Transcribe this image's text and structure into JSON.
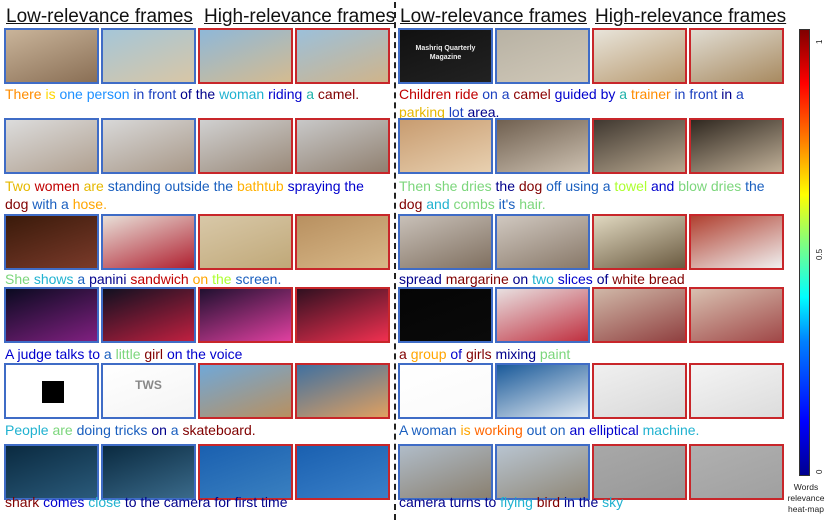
{
  "headers": {
    "left_low": "Low-relevance frames",
    "left_high": "High-relevance frames",
    "right_low": "Low-relevance frames",
    "right_high": "High-relevance frames"
  },
  "colorbar": {
    "tick_top": "1",
    "tick_mid": "0.5",
    "tick_bottom": "0",
    "label": "Words relevance heat-map",
    "gradient_colors": [
      "#00008f",
      "#0000ff",
      "#0080ff",
      "#00ffff",
      "#80ff80",
      "#ffff00",
      "#ff8000",
      "#ff0000",
      "#800000"
    ]
  },
  "rows": [
    {
      "left": {
        "frames": [
          {
            "type": "low",
            "colors": [
              "#c9b49a",
              "#8a6f55"
            ]
          },
          {
            "type": "low",
            "colors": [
              "#a5c6d8",
              "#d8c6a6"
            ]
          },
          {
            "type": "high",
            "colors": [
              "#8fb8d8",
              "#d4bb90"
            ]
          },
          {
            "type": "high",
            "colors": [
              "#9cc0da",
              "#d0b48a"
            ]
          }
        ],
        "words": [
          {
            "t": "There ",
            "c": "#ff8c00"
          },
          {
            "t": "is ",
            "c": "#ffd700"
          },
          {
            "t": "one ",
            "c": "#1e90ff"
          },
          {
            "t": "person ",
            "c": "#1e90ff"
          },
          {
            "t": "in front ",
            "c": "#1a3fbf"
          },
          {
            "t": "of ",
            "c": "#00008b"
          },
          {
            "t": "the ",
            "c": "#00008b"
          },
          {
            "t": "woman ",
            "c": "#20b2d0"
          },
          {
            "t": "riding ",
            "c": "#0000cd"
          },
          {
            "t": "a ",
            "c": "#20b2aa"
          },
          {
            "t": "camel.",
            "c": "#800000"
          }
        ]
      },
      "right": {
        "frames": [
          {
            "type": "low",
            "colors": [
              "#111111",
              "#222222"
            ],
            "text": "Mashriq Quarterly Magazine"
          },
          {
            "type": "low",
            "colors": [
              "#b8b2a4",
              "#d0c8b8"
            ]
          },
          {
            "type": "high",
            "colors": [
              "#e8e4da",
              "#b89a70"
            ]
          },
          {
            "type": "high",
            "colors": [
              "#e0dcd2",
              "#a88a60"
            ]
          }
        ],
        "words": [
          {
            "t": "Children ",
            "c": "#c00000"
          },
          {
            "t": "ride ",
            "c": "#c00000"
          },
          {
            "t": "on ",
            "c": "#1a3fbf"
          },
          {
            "t": "a ",
            "c": "#1a3fbf"
          },
          {
            "t": "camel ",
            "c": "#8b0000"
          },
          {
            "t": "guided ",
            "c": "#0000cd"
          },
          {
            "t": "by ",
            "c": "#0000cd"
          },
          {
            "t": "a ",
            "c": "#20b2aa"
          },
          {
            "t": "trainer ",
            "c": "#ff8c00"
          },
          {
            "t": "in front ",
            "c": "#1a3fbf"
          },
          {
            "t": "in ",
            "c": "#00008b"
          },
          {
            "t": "a ",
            "c": "#1a3fbf"
          },
          {
            "t": "parking ",
            "c": "#e6b800"
          },
          {
            "t": "lot ",
            "c": "#1a3fbf"
          },
          {
            "t": "area.",
            "c": "#00008b"
          }
        ]
      }
    },
    {
      "left": {
        "frames": [
          {
            "type": "low",
            "colors": [
              "#dcdcdc",
              "#b0a090"
            ]
          },
          {
            "type": "low",
            "colors": [
              "#d8d8d8",
              "#a89888"
            ]
          },
          {
            "type": "high",
            "colors": [
              "#d0d0d0",
              "#9a8a7a"
            ]
          },
          {
            "type": "high",
            "colors": [
              "#c8c8c8",
              "#908070"
            ]
          }
        ],
        "words": [
          {
            "t": "Two ",
            "c": "#e6b800"
          },
          {
            "t": "women ",
            "c": "#c00000"
          },
          {
            "t": "are ",
            "c": "#e6b800"
          },
          {
            "t": "standing ",
            "c": "#1a5fbf"
          },
          {
            "t": "outside ",
            "c": "#1a5fbf"
          },
          {
            "t": "the ",
            "c": "#1a5fbf"
          },
          {
            "t": "bathtub ",
            "c": "#ffb000"
          },
          {
            "t": "spraying ",
            "c": "#0000cd"
          },
          {
            "t": "the ",
            "c": "#0000cd"
          },
          {
            "t": "dog ",
            "c": "#800000"
          },
          {
            "t": "with ",
            "c": "#1a5fbf"
          },
          {
            "t": "a ",
            "c": "#1a5fbf"
          },
          {
            "t": "hose.",
            "c": "#ffa500"
          }
        ]
      },
      "right": {
        "frames": [
          {
            "type": "low",
            "colors": [
              "#c89c70",
              "#e8d0b0"
            ]
          },
          {
            "type": "low",
            "colors": [
              "#706050",
              "#ccc0b0"
            ]
          },
          {
            "type": "high",
            "colors": [
              "#403830",
              "#b8a890"
            ]
          },
          {
            "type": "high",
            "colors": [
              "#302820",
              "#c0b098"
            ]
          }
        ],
        "words": [
          {
            "t": "Then ",
            "c": "#7cd67c"
          },
          {
            "t": "she ",
            "c": "#7cd67c"
          },
          {
            "t": "dries ",
            "c": "#7cd67c"
          },
          {
            "t": "the ",
            "c": "#00008b"
          },
          {
            "t": "dog ",
            "c": "#800000"
          },
          {
            "t": "off ",
            "c": "#1a5fbf"
          },
          {
            "t": "using ",
            "c": "#1a5fbf"
          },
          {
            "t": "a ",
            "c": "#1a5fbf"
          },
          {
            "t": "towel ",
            "c": "#adff2f"
          },
          {
            "t": "and ",
            "c": "#0000cd"
          },
          {
            "t": "blow ",
            "c": "#7cd67c"
          },
          {
            "t": "dries ",
            "c": "#7cd67c"
          },
          {
            "t": "the ",
            "c": "#1a5fbf"
          },
          {
            "t": "dog ",
            "c": "#800000"
          },
          {
            "t": "and ",
            "c": "#20b2d0"
          },
          {
            "t": "combs ",
            "c": "#7cd67c"
          },
          {
            "t": "it's ",
            "c": "#1a5fbf"
          },
          {
            "t": "hair.",
            "c": "#7cd67c"
          }
        ]
      }
    },
    {
      "left": {
        "frames": [
          {
            "type": "low",
            "colors": [
              "#3a1a0a",
              "#7a3a2a"
            ]
          },
          {
            "type": "low",
            "colors": [
              "#e8e0d8",
              "#b02030"
            ]
          },
          {
            "type": "high",
            "colors": [
              "#d8c8a8",
              "#c0a878"
            ]
          },
          {
            "type": "high",
            "colors": [
              "#b89060",
              "#d8b888"
            ]
          }
        ],
        "words": [
          {
            "t": "She ",
            "c": "#7cd67c"
          },
          {
            "t": "shows ",
            "c": "#20b2d0"
          },
          {
            "t": "a ",
            "c": "#1a5fbf"
          },
          {
            "t": "panini ",
            "c": "#00008b"
          },
          {
            "t": "sandwich ",
            "c": "#c00000"
          },
          {
            "t": "on ",
            "c": "#ffa500"
          },
          {
            "t": "the ",
            "c": "#adff2f"
          },
          {
            "t": "screen.",
            "c": "#1a5fbf"
          }
        ]
      },
      "right": {
        "frames": [
          {
            "type": "low",
            "colors": [
              "#c8c0b8",
              "#807060"
            ]
          },
          {
            "type": "low",
            "colors": [
              "#d0c8c0",
              "#887868"
            ]
          },
          {
            "type": "high",
            "colors": [
              "#e0d8c0",
              "#6a5a40"
            ]
          },
          {
            "type": "high",
            "colors": [
              "#b04030",
              "#f0f0f0"
            ]
          }
        ],
        "words": [
          {
            "t": "spread ",
            "c": "#00008b"
          },
          {
            "t": "margarine ",
            "c": "#800000"
          },
          {
            "t": "on ",
            "c": "#00008b"
          },
          {
            "t": "two ",
            "c": "#20b2d0"
          },
          {
            "t": "slices ",
            "c": "#0000cd"
          },
          {
            "t": "of ",
            "c": "#00008b"
          },
          {
            "t": "white ",
            "c": "#800000"
          },
          {
            "t": "bread",
            "c": "#800000"
          }
        ]
      }
    },
    {
      "left": {
        "frames": [
          {
            "type": "low",
            "colors": [
              "#0a0a20",
              "#802080"
            ]
          },
          {
            "type": "low",
            "colors": [
              "#101020",
              "#c02040"
            ]
          },
          {
            "type": "high",
            "colors": [
              "#201030",
              "#e040a0"
            ]
          },
          {
            "type": "high",
            "colors": [
              "#301020",
              "#f03050"
            ]
          }
        ],
        "words": [
          {
            "t": "A ",
            "c": "#0000cd"
          },
          {
            "t": "judge ",
            "c": "#0000cd"
          },
          {
            "t": "talks ",
            "c": "#0000cd"
          },
          {
            "t": "to ",
            "c": "#0000cd"
          },
          {
            "t": "a ",
            "c": "#1a5fbf"
          },
          {
            "t": "little ",
            "c": "#7cd67c"
          },
          {
            "t": "girl ",
            "c": "#800000"
          },
          {
            "t": "on ",
            "c": "#0000cd"
          },
          {
            "t": "the ",
            "c": "#0000cd"
          },
          {
            "t": "voice",
            "c": "#0000cd"
          }
        ]
      },
      "right": {
        "frames": [
          {
            "type": "low",
            "colors": [
              "#050505",
              "#0a0a0a"
            ]
          },
          {
            "type": "low",
            "colors": [
              "#e8e0e0",
              "#c03040"
            ]
          },
          {
            "type": "high",
            "colors": [
              "#d0b8a8",
              "#904040"
            ]
          },
          {
            "type": "high",
            "colors": [
              "#d8c0b0",
              "#a04848"
            ]
          }
        ],
        "words": [
          {
            "t": "a ",
            "c": "#800000"
          },
          {
            "t": "group ",
            "c": "#ffa500"
          },
          {
            "t": "of ",
            "c": "#0000cd"
          },
          {
            "t": "girls ",
            "c": "#800000"
          },
          {
            "t": "mixing ",
            "c": "#00008b"
          },
          {
            "t": "paint",
            "c": "#7cd67c"
          }
        ]
      }
    },
    {
      "left": {
        "frames": [
          {
            "type": "low",
            "colors": [
              "#ffffff",
              "#ffffff"
            ]
          },
          {
            "type": "low",
            "colors": [
              "#ffffff",
              "#f4f4f4"
            ],
            "text": "TWS"
          },
          {
            "type": "high",
            "colors": [
              "#70a8d8",
              "#b89060"
            ]
          },
          {
            "type": "high",
            "colors": [
              "#4070a0",
              "#e0a060"
            ]
          }
        ],
        "words": [
          {
            "t": "People ",
            "c": "#20b2d0"
          },
          {
            "t": "are ",
            "c": "#7cd67c"
          },
          {
            "t": "doing ",
            "c": "#1a5fbf"
          },
          {
            "t": "tricks ",
            "c": "#1a5fbf"
          },
          {
            "t": "on ",
            "c": "#00008b"
          },
          {
            "t": "a ",
            "c": "#1a5fbf"
          },
          {
            "t": "skateboard.",
            "c": "#800000"
          }
        ]
      },
      "right": {
        "frames": [
          {
            "type": "low",
            "colors": [
              "#ffffff",
              "#fafafa"
            ]
          },
          {
            "type": "low",
            "colors": [
              "#1a5a9a",
              "#e0e8f0"
            ]
          },
          {
            "type": "high",
            "colors": [
              "#f0f0f0",
              "#d8d8d8"
            ]
          },
          {
            "type": "high",
            "colors": [
              "#f4f4f4",
              "#dcdcdc"
            ]
          }
        ],
        "words": [
          {
            "t": "A ",
            "c": "#1a5fbf"
          },
          {
            "t": "woman ",
            "c": "#1a5fbf"
          },
          {
            "t": "is ",
            "c": "#ffa500"
          },
          {
            "t": "working ",
            "c": "#ff6600"
          },
          {
            "t": "out ",
            "c": "#1a5fbf"
          },
          {
            "t": "on ",
            "c": "#1a5fbf"
          },
          {
            "t": "an ",
            "c": "#0000cd"
          },
          {
            "t": "elliptical ",
            "c": "#0000cd"
          },
          {
            "t": "machine.",
            "c": "#20b2d0"
          }
        ]
      }
    },
    {
      "left": {
        "frames": [
          {
            "type": "low",
            "colors": [
              "#0a2a40",
              "#2a5a7a"
            ]
          },
          {
            "type": "low",
            "colors": [
              "#0a2a40",
              "#3a6a8a"
            ]
          },
          {
            "type": "high",
            "colors": [
              "#1a60b0",
              "#3a80c0"
            ]
          },
          {
            "type": "high",
            "colors": [
              "#1a60b0",
              "#3a80c8"
            ]
          }
        ],
        "words": [
          {
            "t": "shark ",
            "c": "#800000"
          },
          {
            "t": "comes ",
            "c": "#0000cd"
          },
          {
            "t": "close ",
            "c": "#20b2d0"
          },
          {
            "t": "to ",
            "c": "#00008b"
          },
          {
            "t": "the ",
            "c": "#00008b"
          },
          {
            "t": "camera ",
            "c": "#00008b"
          },
          {
            "t": "for ",
            "c": "#00008b"
          },
          {
            "t": "first ",
            "c": "#00008b"
          },
          {
            "t": "time",
            "c": "#00008b"
          }
        ]
      },
      "right": {
        "frames": [
          {
            "type": "low",
            "colors": [
              "#b0bcc8",
              "#8a8070"
            ]
          },
          {
            "type": "low",
            "colors": [
              "#b8c4d0",
              "#908878"
            ]
          },
          {
            "type": "high",
            "colors": [
              "#a8a8a8",
              "#989898"
            ]
          },
          {
            "type": "high",
            "colors": [
              "#b0b0b0",
              "#a0a0a0"
            ]
          }
        ],
        "words": [
          {
            "t": "camera ",
            "c": "#00008b"
          },
          {
            "t": "turns ",
            "c": "#00008b"
          },
          {
            "t": "to ",
            "c": "#00008b"
          },
          {
            "t": "flying ",
            "c": "#20b2d0"
          },
          {
            "t": "bird ",
            "c": "#800000"
          },
          {
            "t": "in ",
            "c": "#00008b"
          },
          {
            "t": "the ",
            "c": "#00008b"
          },
          {
            "t": "sky",
            "c": "#20b2d0"
          }
        ]
      }
    }
  ]
}
